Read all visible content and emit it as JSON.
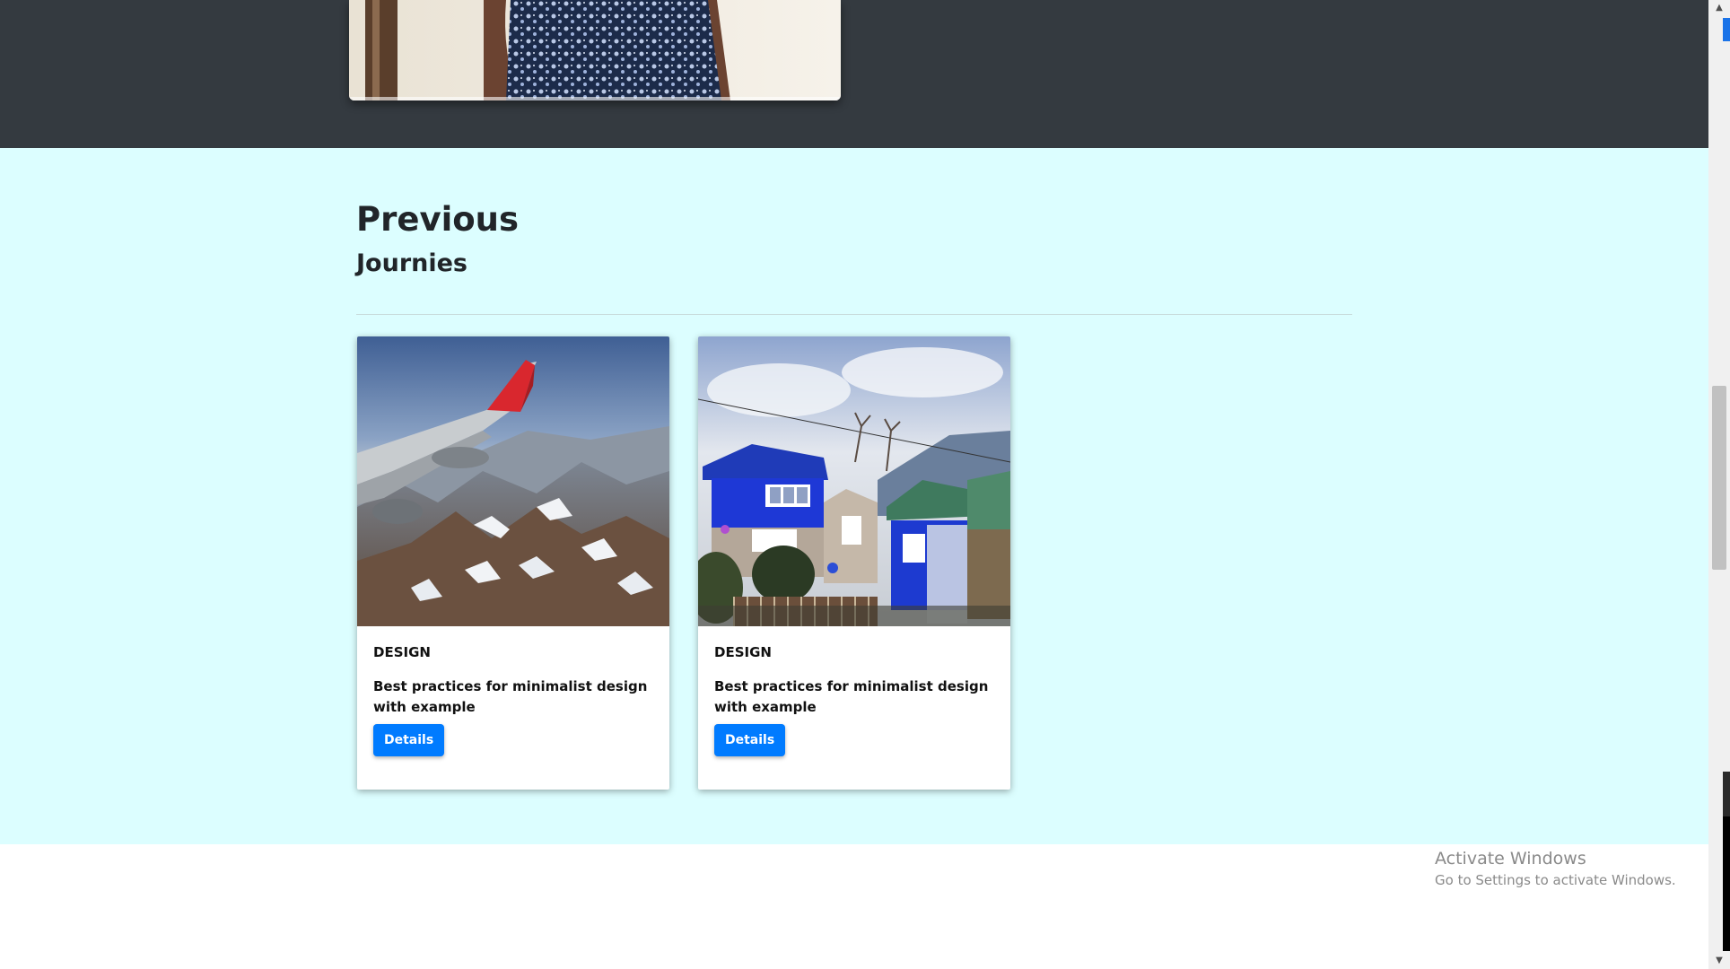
{
  "journeys": {
    "title": "Previous",
    "subtitle": "Journies",
    "cards": [
      {
        "category": "DESIGN",
        "text": "Best practices for minimalist design with example",
        "button_label": "Details",
        "image": "airplane-wing-over-mountains"
      },
      {
        "category": "DESIGN",
        "text": "Best practices for minimalist design with example",
        "button_label": "Details",
        "image": "blue-houses-village"
      }
    ]
  },
  "watermark": {
    "title": "Activate Windows",
    "subtitle": "Go to Settings to activate Windows."
  },
  "colors": {
    "dark_section": "#343a40",
    "light_section": "#dcfeff",
    "button": "#007bff"
  }
}
